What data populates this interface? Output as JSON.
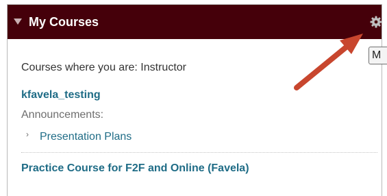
{
  "module": {
    "title": "My Courses",
    "settings_tooltip": "M",
    "role_heading": "Courses where you are: Instructor",
    "courses": [
      {
        "name": "kfavela_testing",
        "announcements_label": "Announcements:",
        "announcement_chevron": "›",
        "announcements": [
          "Presentation Plans"
        ]
      },
      {
        "name": "Practice Course for F2F and Online (Favela)"
      }
    ]
  },
  "colors": {
    "header_bg": "#45000a",
    "link": "#1f6c86",
    "annotation_arrow": "#c8462e"
  },
  "icons": {
    "collapse": "triangle-down-icon",
    "settings": "gear-icon",
    "pointer": "arrow-annotation"
  }
}
